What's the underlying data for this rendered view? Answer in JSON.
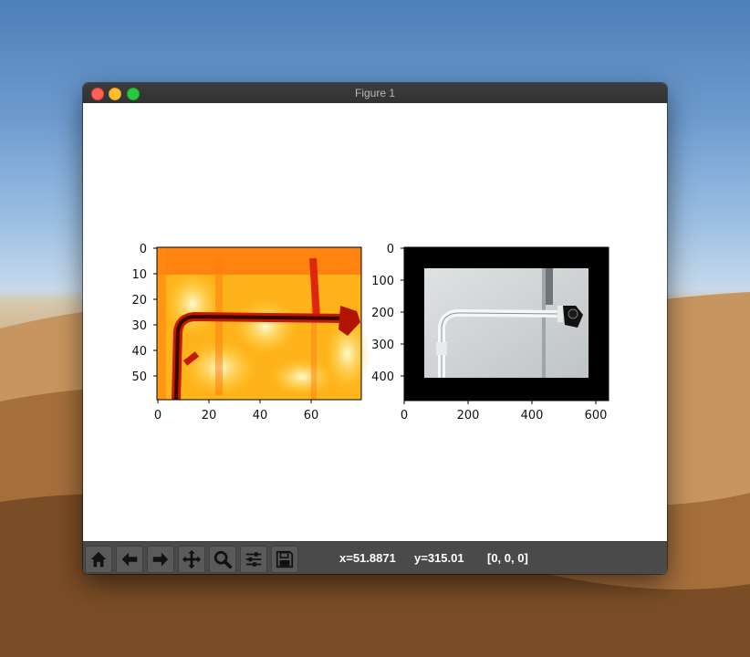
{
  "window": {
    "title": "Figure 1"
  },
  "plot_left": {
    "y_ticks": [
      "0",
      "10",
      "20",
      "30",
      "40",
      "50"
    ],
    "x_ticks": [
      "0",
      "20",
      "40",
      "60"
    ]
  },
  "plot_right": {
    "y_ticks": [
      "0",
      "100",
      "200",
      "300",
      "400"
    ],
    "x_ticks": [
      "0",
      "200",
      "400",
      "600"
    ]
  },
  "toolbar": {
    "buttons": [
      "home-icon",
      "back-arrow-icon",
      "forward-arrow-icon",
      "pan-icon",
      "zoom-icon",
      "subplots-config-icon",
      "save-icon"
    ],
    "x_readout": "x=51.8871",
    "y_readout": "y=315.01",
    "pixel_value": "[0, 0, 0]"
  }
}
